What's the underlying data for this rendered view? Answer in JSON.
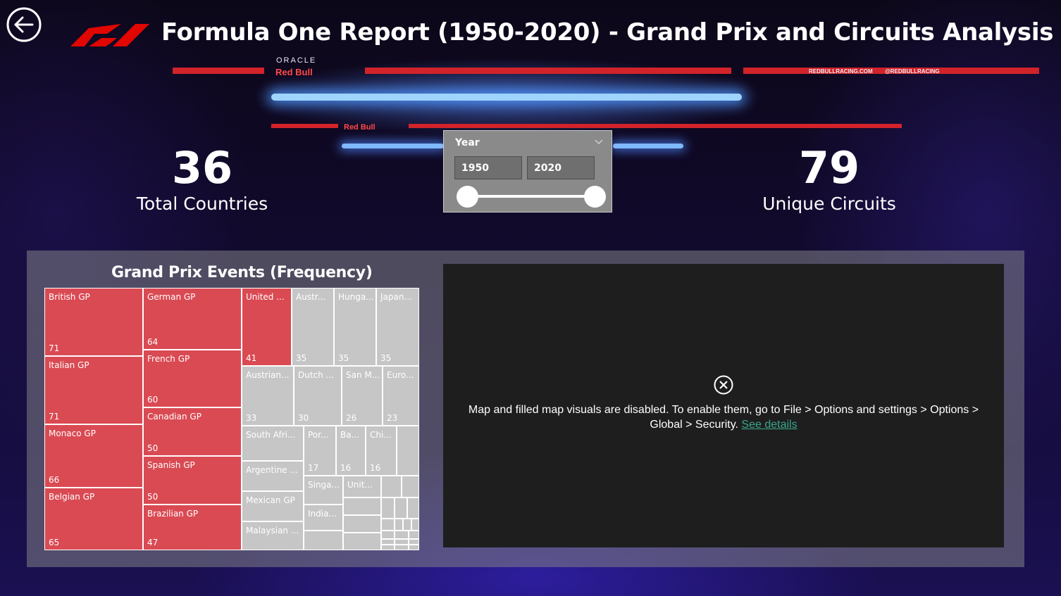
{
  "header": {
    "title": "Formula One Report (1950-2020) - Grand Prix and Circuits Analysis",
    "back_icon": "back-arrow-icon",
    "logo_icon": "f1-logo-icon",
    "accent_color": "#e10600"
  },
  "background": {
    "sponsor_1": "Red Bull",
    "sponsor_2": "ORACLE",
    "sponsor_3": "REDBULLRACING.COM",
    "sponsor_4": "@REDBULLRACING",
    "sponsor_5": "Red Bull"
  },
  "kpis": {
    "countries": {
      "value": "36",
      "label": "Total Countries"
    },
    "circuits": {
      "value": "79",
      "label": "Unique Circuits"
    }
  },
  "slicer": {
    "title": "Year",
    "start": "1950",
    "end": "2020",
    "chevron_icon": "chevron-down-icon"
  },
  "treemap": {
    "title": "Grand Prix Events (Frequency)",
    "highlight_color": "#da4a53",
    "base_color": "#c6c6c6",
    "cells": [
      {
        "label": "British GP",
        "value": "71",
        "highlight": true
      },
      {
        "label": "Italian GP",
        "value": "71",
        "highlight": true
      },
      {
        "label": "Monaco GP",
        "value": "66",
        "highlight": true
      },
      {
        "label": "Belgian GP",
        "value": "65",
        "highlight": true
      },
      {
        "label": "German GP",
        "value": "64",
        "highlight": true
      },
      {
        "label": "French GP",
        "value": "60",
        "highlight": true
      },
      {
        "label": "Canadian GP",
        "value": "50",
        "highlight": true
      },
      {
        "label": "Spanish GP",
        "value": "50",
        "highlight": true
      },
      {
        "label": "Brazilian GP",
        "value": "47",
        "highlight": true
      },
      {
        "label": "United ...",
        "value": "41",
        "highlight": true
      },
      {
        "label": "Austr...",
        "value": "35"
      },
      {
        "label": "Hunga...",
        "value": "35"
      },
      {
        "label": "Japan...",
        "value": "35"
      },
      {
        "label": "Austrian...",
        "value": "33"
      },
      {
        "label": "Dutch ...",
        "value": "30"
      },
      {
        "label": "San M...",
        "value": "26"
      },
      {
        "label": "Euro...",
        "value": "23"
      },
      {
        "label": "South Afri...",
        "value": ""
      },
      {
        "label": "Argentine ...",
        "value": ""
      },
      {
        "label": "Mexican GP",
        "value": ""
      },
      {
        "label": "Malaysian ...",
        "value": ""
      },
      {
        "label": "Por...",
        "value": "17"
      },
      {
        "label": "Ba...",
        "value": "16"
      },
      {
        "label": "Chi...",
        "value": "16"
      },
      {
        "label": "Singa...",
        "value": ""
      },
      {
        "label": "Unit...",
        "value": ""
      },
      {
        "label": "India...",
        "value": ""
      }
    ]
  },
  "map": {
    "icon": "error-circle-icon",
    "message_line1": "Map and filled map visuals are disabled. To enable them, go to File > Options and settings > Options >",
    "message_line2": "Global > Security.",
    "link": "See details"
  }
}
